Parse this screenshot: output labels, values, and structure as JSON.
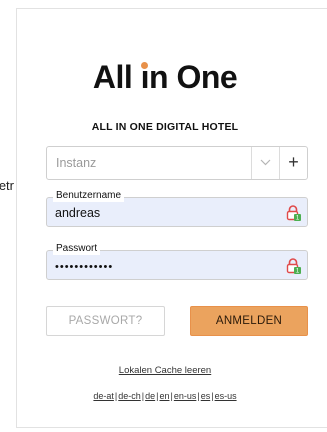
{
  "stray_text": "etr",
  "brand": {
    "logo_part1": "All ",
    "logo_i": "ı",
    "logo_part2": "n One",
    "subtitle": "ALL IN ONE DIGITAL HOTEL",
    "accent_color": "#e8914a"
  },
  "instance_select": {
    "placeholder": "Instanz",
    "add_symbol": "+"
  },
  "username": {
    "label": "Benutzername",
    "value": "andreas"
  },
  "password": {
    "label": "Passwort",
    "value": "••••••••••••"
  },
  "buttons": {
    "forgot_label": "PASSWORT?",
    "login_label": "ANMELDEN"
  },
  "cache_link": "Lokalen Cache leeren",
  "languages": [
    {
      "code": "de-at"
    },
    {
      "code": "de-ch"
    },
    {
      "code": "de"
    },
    {
      "code": "en"
    },
    {
      "code": "en-us"
    },
    {
      "code": "es"
    },
    {
      "code": "es-us"
    }
  ],
  "language_separator": "|",
  "icons": {
    "lock": "lock-icon",
    "chevron": "chevron-down-icon",
    "plus": "plus-icon"
  }
}
